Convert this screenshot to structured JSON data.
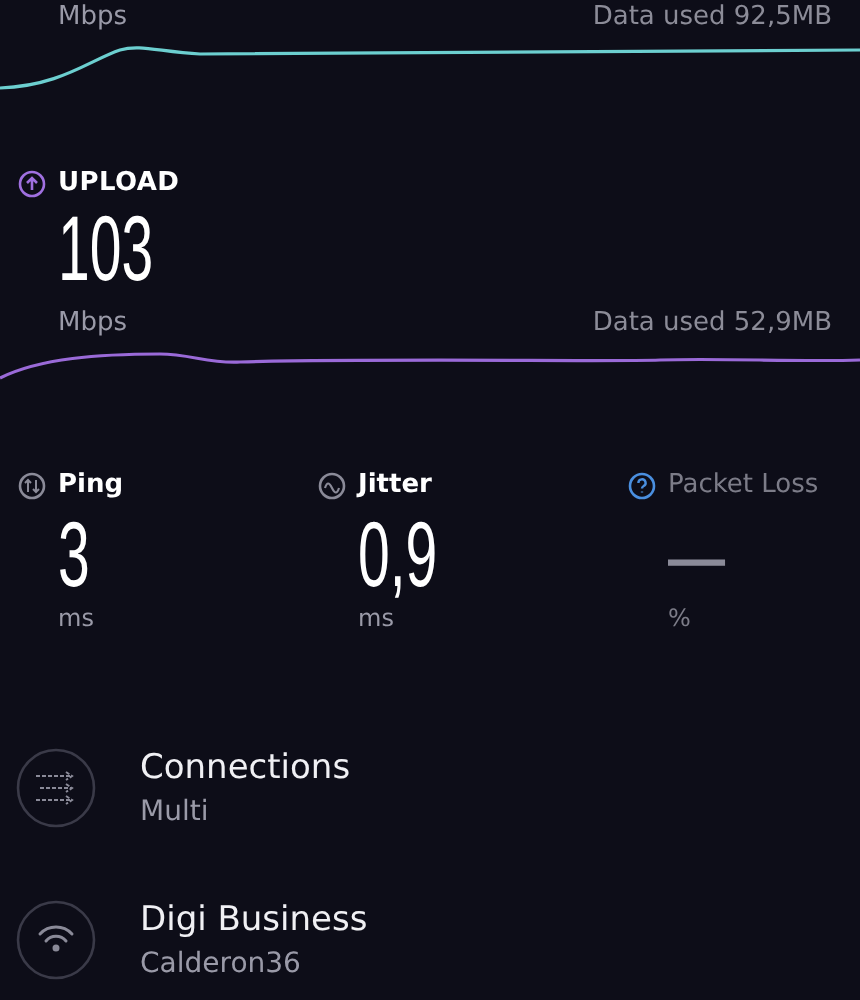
{
  "download": {
    "unit": "Mbps",
    "data_used": "Data used 92,5MB"
  },
  "upload": {
    "label": "UPLOAD",
    "value": "103",
    "unit": "Mbps",
    "data_used": "Data used 52,9MB"
  },
  "metrics": [
    {
      "kind": "ping",
      "label": "Ping",
      "value": "3",
      "unit": "ms"
    },
    {
      "kind": "jitter",
      "label": "Jitter",
      "value": "0,9",
      "unit": "ms"
    },
    {
      "kind": "packet_loss",
      "label": "Packet Loss",
      "value": "—",
      "unit": "%"
    }
  ],
  "info": [
    {
      "kind": "connections",
      "title": "Connections",
      "subtitle": "Multi"
    },
    {
      "kind": "wifi",
      "title": "Digi Business",
      "subtitle": "Calderon36"
    }
  ]
}
